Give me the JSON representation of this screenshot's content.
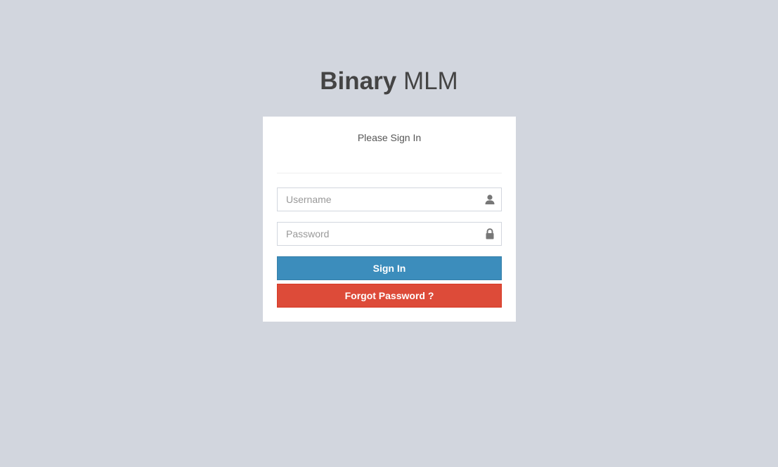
{
  "logo": {
    "bold": "Binary",
    "light": "MLM"
  },
  "login_box": {
    "message": "Please Sign In",
    "username": {
      "placeholder": "Username",
      "value": "",
      "icon": "user-icon"
    },
    "password": {
      "placeholder": "Password",
      "value": "",
      "icon": "lock-icon"
    },
    "signin_label": "Sign In",
    "forgot_label": "Forgot Password ?"
  },
  "colors": {
    "background": "#d2d6de",
    "signin_button": "#3c8dbc",
    "forgot_button": "#dd4b39",
    "icon": "#777777"
  }
}
